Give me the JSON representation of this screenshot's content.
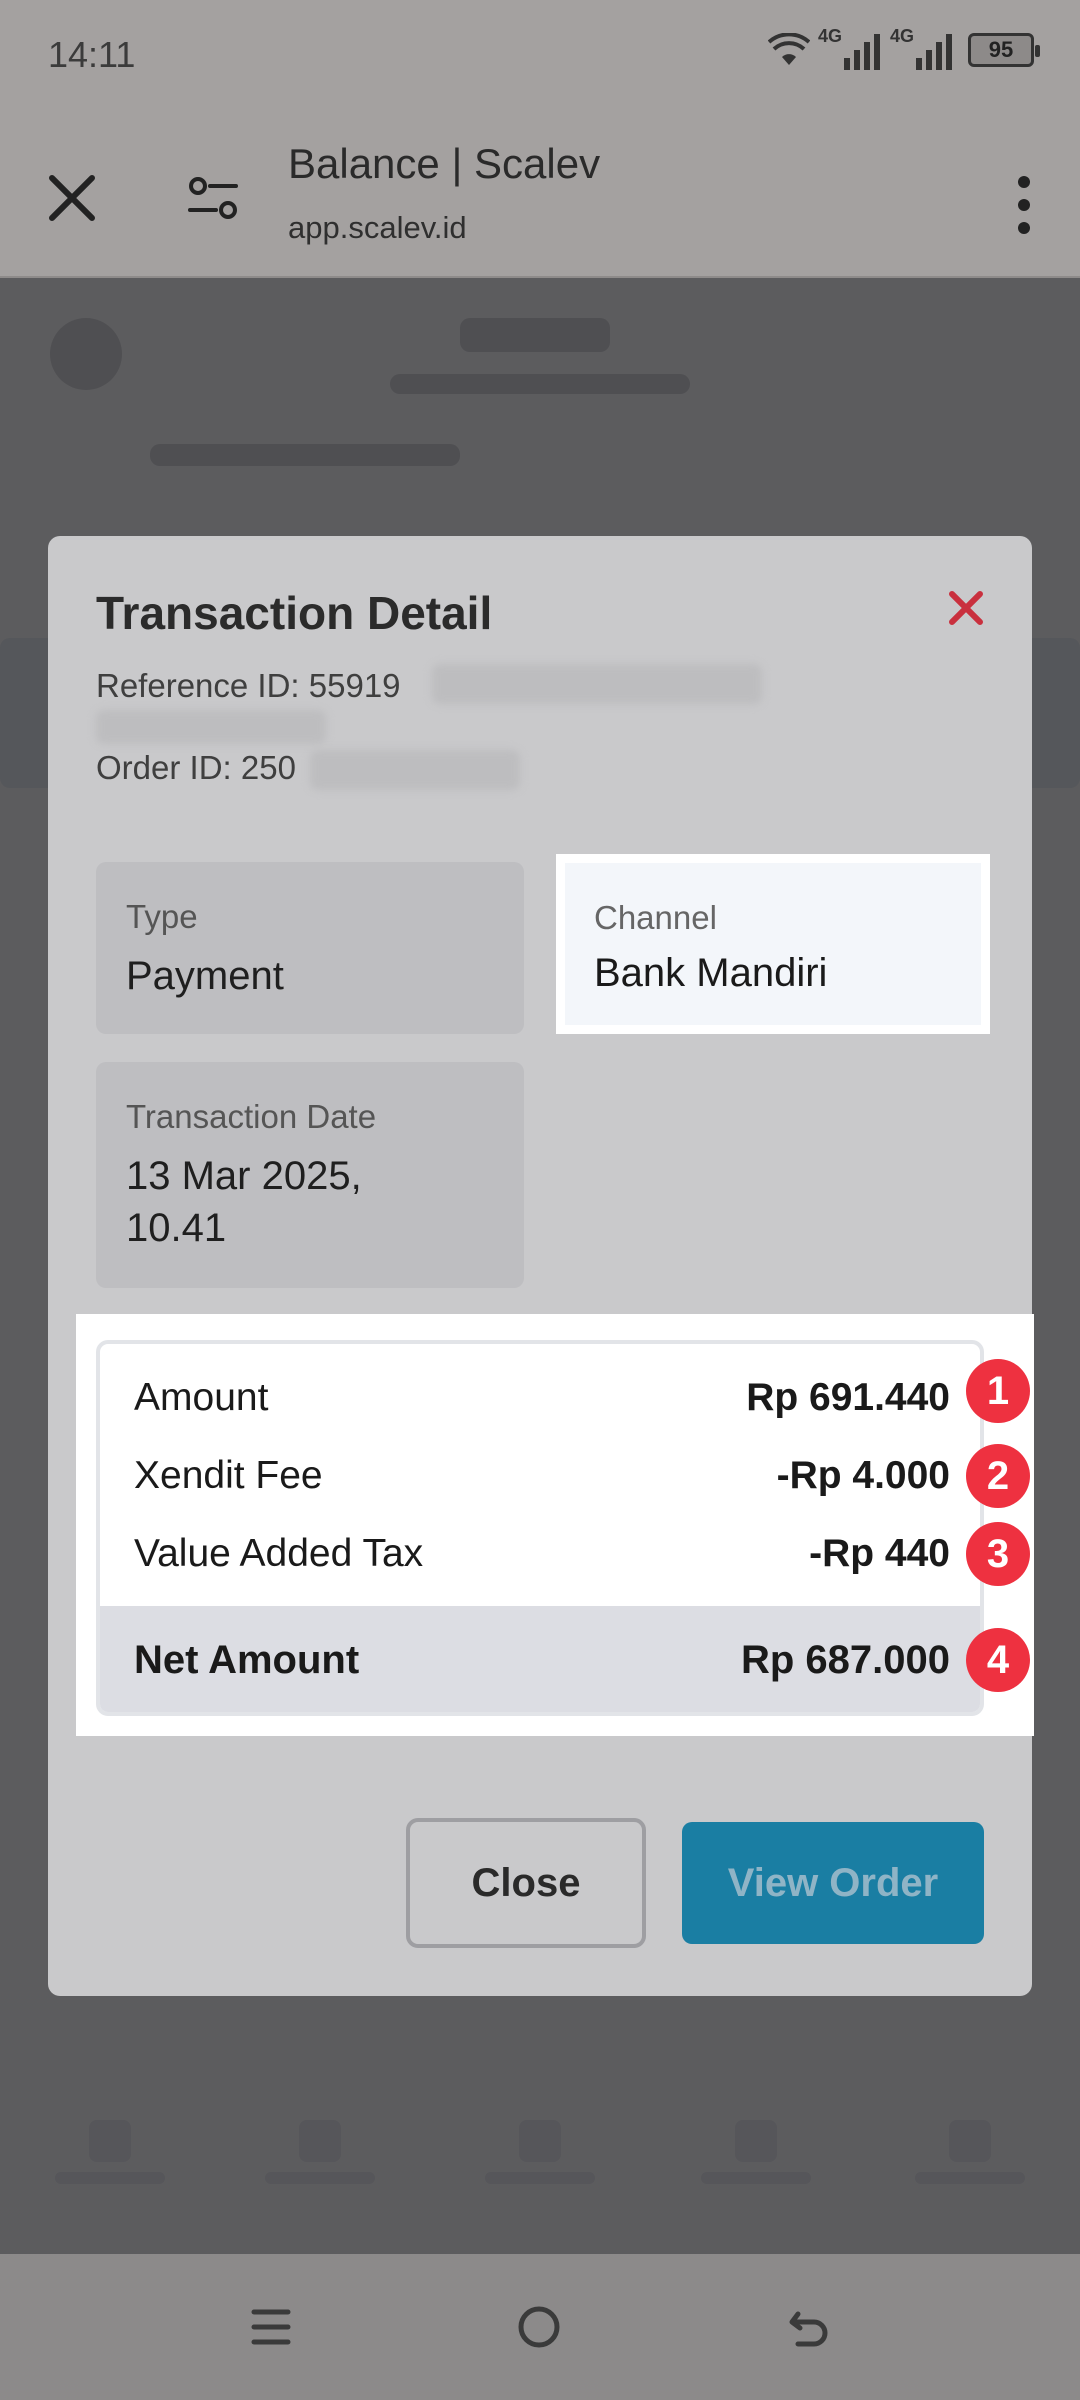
{
  "status_bar": {
    "time": "14:11",
    "net1": "4G",
    "net2": "4G",
    "battery": "95"
  },
  "browser": {
    "title": "Balance | Scalev",
    "url": "app.scalev.id"
  },
  "modal": {
    "title": "Transaction Detail",
    "reference_label": "Reference ID: 55919",
    "order_label": "Order ID: 250",
    "type_label": "Type",
    "type_value": "Payment",
    "channel_label": "Channel",
    "channel_value": "Bank Mandiri",
    "date_label": "Transaction Date",
    "date_value_line1": "13 Mar 2025,",
    "date_value_line2": "10.41",
    "summary": [
      {
        "label": "Amount",
        "value": "Rp 691.440",
        "badge": "1"
      },
      {
        "label": "Xendit Fee",
        "value": "-Rp 4.000",
        "badge": "2"
      },
      {
        "label": "Value Added Tax",
        "value": "-Rp 440",
        "badge": "3"
      }
    ],
    "net": {
      "label": "Net Amount",
      "value": "Rp 687.000",
      "badge": "4"
    },
    "close_label": "Close",
    "view_order_label": "View Order"
  },
  "colors": {
    "accent": "#1a7ea3",
    "badge": "#ee3140",
    "close_x": "#c9303e"
  }
}
